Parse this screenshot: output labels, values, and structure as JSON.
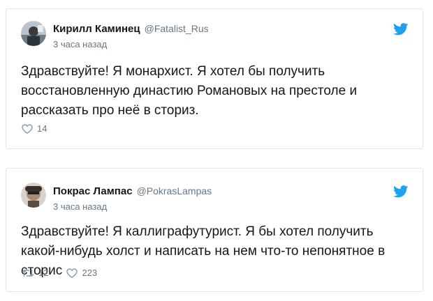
{
  "tweets": [
    {
      "display_name": "Кирилл Каминец",
      "handle": "@Fatalist_Rus",
      "time": "3 часа назад",
      "text": "Здравствуйте! Я монархист. Я хотел бы получить восстановленную династию Романовых на престоле и рассказать про неё в сториз.",
      "likes": "14",
      "avatar_icon": "avatar-photo",
      "brand_icon": "twitter-bird-icon",
      "accent_color": "#1da1f2"
    },
    {
      "display_name": "Покрас Лампас",
      "handle": "@PokrasLampas",
      "time": "3 часа назад",
      "text": "Здравствуйте! Я каллиграфутурист. Я бы хотел получить какой-нибудь холст и написать на нем что-то непонятное в сторис",
      "retweets": "12",
      "likes": "223",
      "avatar_icon": "avatar-photo",
      "brand_icon": "twitter-bird-icon",
      "accent_color": "#1da1f2"
    }
  ]
}
